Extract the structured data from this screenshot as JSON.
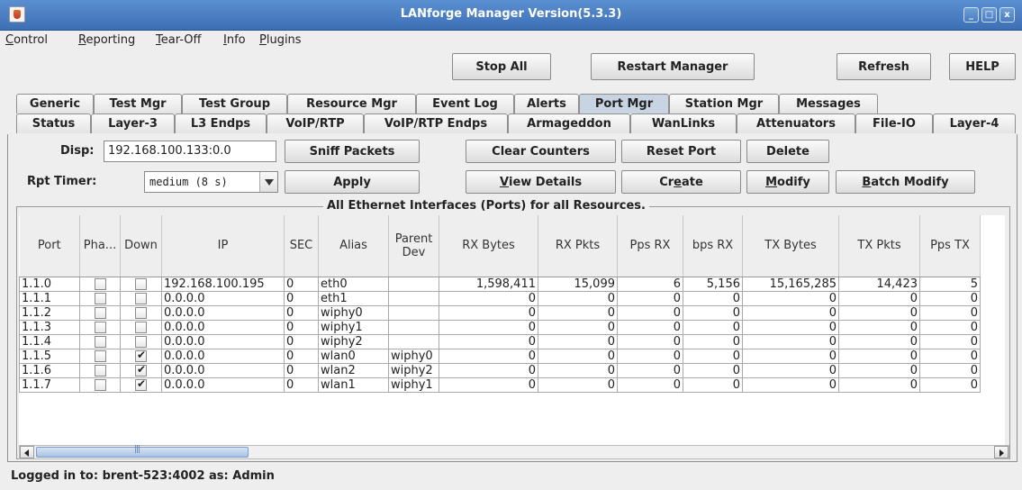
{
  "window": {
    "title": "LANforge Manager   Version(5.3.3)",
    "controls": {
      "minimize": "_",
      "maximize": "□",
      "close": "x"
    }
  },
  "menu": {
    "items": [
      {
        "pre": "",
        "u": "C",
        "post": "ontrol"
      },
      {
        "pre": "",
        "u": "R",
        "post": "eporting"
      },
      {
        "pre": "",
        "u": "T",
        "post": "ear-Off"
      },
      {
        "pre": "",
        "u": "I",
        "post": "nfo"
      },
      {
        "pre": "",
        "u": "P",
        "post": "lugins"
      }
    ]
  },
  "toolbar": {
    "stop_all": "Stop All",
    "restart_manager": "Restart Manager",
    "refresh": "Refresh",
    "help": "HELP"
  },
  "tabs": {
    "row1": [
      "Generic",
      "Test Mgr",
      "Test Group",
      "Resource Mgr",
      "Event Log",
      "Alerts",
      "Port Mgr",
      "Station Mgr",
      "Messages"
    ],
    "row2": [
      "Status",
      "Layer-3",
      "L3 Endps",
      "VoIP/RTP",
      "VoIP/RTP Endps",
      "Armageddon",
      "WanLinks",
      "Attenuators",
      "File-IO",
      "Layer-4"
    ],
    "active": "Port Mgr"
  },
  "controls": {
    "disp_label": "Disp:",
    "disp_value": "192.168.100.133:0.0",
    "rpt_label": "Rpt Timer:",
    "rpt_value": "medium   (8 s)",
    "sniff": "Sniff Packets",
    "apply": "Apply",
    "clear_counters": "Clear Counters",
    "reset_port": "Reset Port",
    "delete": "Delete",
    "view_details": {
      "u": "V",
      "rest": "iew Details"
    },
    "create": {
      "pre": "Cr",
      "u": "e",
      "post": "ate"
    },
    "modify": {
      "u": "M",
      "rest": "odify"
    },
    "batch_modify": {
      "u": "B",
      "rest": "atch Modify"
    }
  },
  "table": {
    "title": "All Ethernet Interfaces (Ports) for all Resources.",
    "columns": [
      "Port",
      "Pha...",
      "Down",
      "IP",
      "SEC",
      "Alias",
      "Parent Dev",
      "RX Bytes",
      "RX Pkts",
      "Pps RX",
      "bps RX",
      "TX Bytes",
      "TX Pkts",
      "Pps TX"
    ],
    "rows": [
      {
        "port": "1.1.0",
        "phantom": false,
        "down": false,
        "ip": "192.168.100.195",
        "sec": "0",
        "alias": "eth0",
        "parent": "",
        "rx_bytes": "1,598,411",
        "rx_pkts": "15,099",
        "pps_rx": "6",
        "bps_rx": "5,156",
        "tx_bytes": "15,165,285",
        "tx_pkts": "14,423",
        "pps_tx": "5"
      },
      {
        "port": "1.1.1",
        "phantom": false,
        "down": false,
        "ip": "0.0.0.0",
        "sec": "0",
        "alias": "eth1",
        "parent": "",
        "rx_bytes": "0",
        "rx_pkts": "0",
        "pps_rx": "0",
        "bps_rx": "0",
        "tx_bytes": "0",
        "tx_pkts": "0",
        "pps_tx": "0"
      },
      {
        "port": "1.1.2",
        "phantom": false,
        "down": false,
        "ip": "0.0.0.0",
        "sec": "0",
        "alias": "wiphy0",
        "parent": "",
        "rx_bytes": "0",
        "rx_pkts": "0",
        "pps_rx": "0",
        "bps_rx": "0",
        "tx_bytes": "0",
        "tx_pkts": "0",
        "pps_tx": "0"
      },
      {
        "port": "1.1.3",
        "phantom": false,
        "down": false,
        "ip": "0.0.0.0",
        "sec": "0",
        "alias": "wiphy1",
        "parent": "",
        "rx_bytes": "0",
        "rx_pkts": "0",
        "pps_rx": "0",
        "bps_rx": "0",
        "tx_bytes": "0",
        "tx_pkts": "0",
        "pps_tx": "0"
      },
      {
        "port": "1.1.4",
        "phantom": false,
        "down": false,
        "ip": "0.0.0.0",
        "sec": "0",
        "alias": "wiphy2",
        "parent": "",
        "rx_bytes": "0",
        "rx_pkts": "0",
        "pps_rx": "0",
        "bps_rx": "0",
        "tx_bytes": "0",
        "tx_pkts": "0",
        "pps_tx": "0"
      },
      {
        "port": "1.1.5",
        "phantom": false,
        "down": true,
        "ip": "0.0.0.0",
        "sec": "0",
        "alias": "wlan0",
        "parent": "wiphy0",
        "rx_bytes": "0",
        "rx_pkts": "0",
        "pps_rx": "0",
        "bps_rx": "0",
        "tx_bytes": "0",
        "tx_pkts": "0",
        "pps_tx": "0"
      },
      {
        "port": "1.1.6",
        "phantom": false,
        "down": true,
        "ip": "0.0.0.0",
        "sec": "0",
        "alias": "wlan2",
        "parent": "wiphy2",
        "rx_bytes": "0",
        "rx_pkts": "0",
        "pps_rx": "0",
        "bps_rx": "0",
        "tx_bytes": "0",
        "tx_pkts": "0",
        "pps_tx": "0"
      },
      {
        "port": "1.1.7",
        "phantom": false,
        "down": true,
        "ip": "0.0.0.0",
        "sec": "0",
        "alias": "wlan1",
        "parent": "wiphy1",
        "rx_bytes": "0",
        "rx_pkts": "0",
        "pps_rx": "0",
        "bps_rx": "0",
        "tx_bytes": "0",
        "tx_pkts": "0",
        "pps_tx": "0"
      }
    ]
  },
  "status": {
    "text": "Logged in to:  brent-523:4002  as:  Admin"
  }
}
